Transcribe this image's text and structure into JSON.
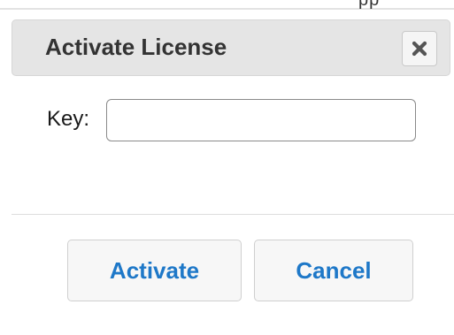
{
  "dialog": {
    "title": "Activate License",
    "close_icon": "close-icon",
    "truncated_background_text": "pp"
  },
  "form": {
    "key_label": "Key:",
    "key_value": "",
    "key_placeholder": ""
  },
  "buttons": {
    "activate_label": "Activate",
    "cancel_label": "Cancel"
  },
  "colors": {
    "header_bg": "#e5e5e5",
    "button_text": "#1e78c8",
    "title_text": "#333333"
  }
}
